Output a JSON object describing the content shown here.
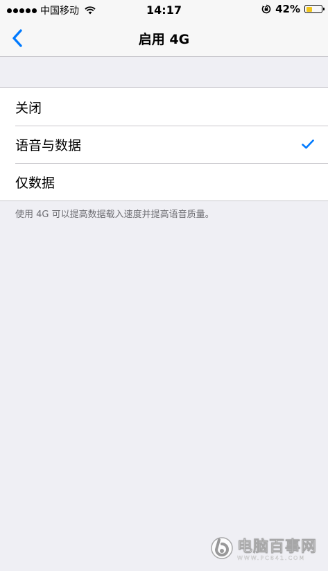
{
  "status_bar": {
    "carrier": "中国移动",
    "time": "14:17",
    "battery_percent": "42%",
    "battery_level": 0.42,
    "battery_color": "#f0c419"
  },
  "nav": {
    "title": "启用 4G",
    "back_icon": "chevron-left-icon",
    "accent_color": "#007aff"
  },
  "options": [
    {
      "label": "关闭",
      "selected": false
    },
    {
      "label": "语音与数据",
      "selected": true
    },
    {
      "label": "仅数据",
      "selected": false
    }
  ],
  "footer_note": "使用 4G 可以提高数据载入速度并提高语音质量。",
  "watermark": {
    "name": "电脑百事网",
    "url": "WWW.PC841.COM"
  }
}
